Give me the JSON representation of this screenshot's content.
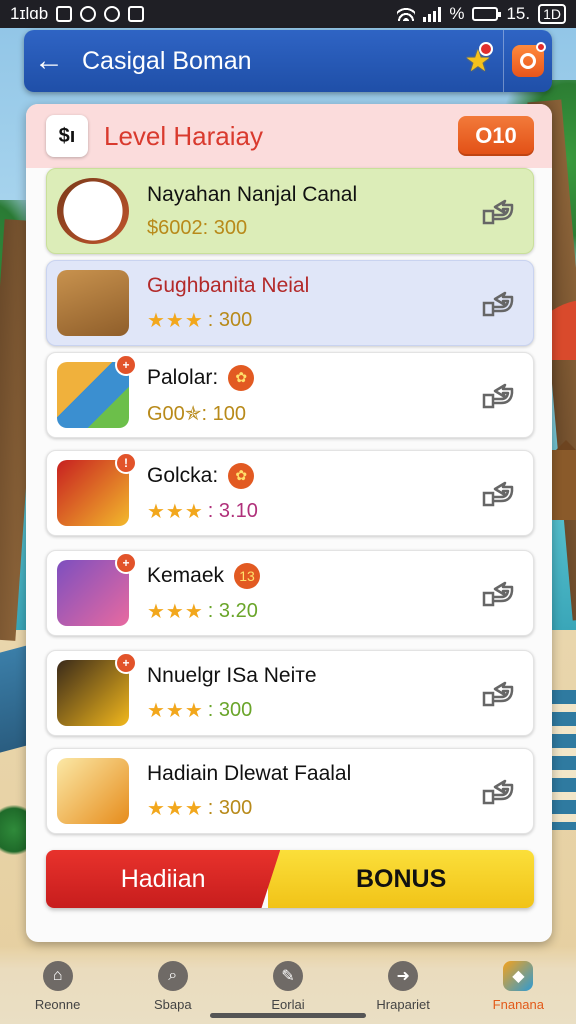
{
  "status_bar": {
    "time_left": "1ɪlɑb",
    "percent": "%",
    "time_right": "15.",
    "right_badge": "1D"
  },
  "header": {
    "title": "Casigal Boman",
    "back_icon": "back-arrow-icon",
    "star_icon": "star-icon",
    "gift_icon": "gift-icon"
  },
  "level": {
    "icon_text": "$ı",
    "title": "Level Haraiay",
    "badge": "O10"
  },
  "items": [
    {
      "title": "Nayahan Nanjal Canal",
      "stars": "",
      "value": "$6002: 300",
      "style": "green",
      "value_color": "#b88a1a",
      "has_title_badge": false,
      "badge": ""
    },
    {
      "title": "Gughbanita Neial",
      "stars": "★★★",
      "value": ": 300",
      "style": "blue",
      "value_color": "#b88a1a",
      "has_title_badge": false,
      "badge": ""
    },
    {
      "title": "Palolar:",
      "stars": "",
      "value": "G00✯: 100",
      "style": "white",
      "value_color": "#b88a1a",
      "has_title_badge": true,
      "title_badge": "✿",
      "badge": "+"
    },
    {
      "title": "Golcka:",
      "stars": "★★★",
      "value": ": 3.10",
      "style": "white",
      "value_color": "#b0307a",
      "has_title_badge": true,
      "title_badge": "✿",
      "badge": "!"
    },
    {
      "title": "Kemaek",
      "stars": "★★★",
      "value": ": 3.20",
      "style": "white",
      "value_color": "#6aa52a",
      "has_title_badge": true,
      "title_badge": "13",
      "badge": "+"
    },
    {
      "title": "Nnuelgr ISa Neiтe",
      "stars": "★★★",
      "value": ": 300",
      "style": "white",
      "value_color": "#6aa52a",
      "has_title_badge": false,
      "badge": "+"
    },
    {
      "title": "Hadiain Dlewat Faalal",
      "stars": "★★★",
      "value": ": 300",
      "style": "white",
      "value_color": "#b88a1a",
      "has_title_badge": false,
      "badge": ""
    }
  ],
  "bonus": {
    "left_label": "Hadiian",
    "right_label": "BONUS"
  },
  "nav": [
    {
      "label": "Reonne",
      "icon": "home-icon",
      "glyph": "⌂",
      "active": false
    },
    {
      "label": "Sbapa",
      "icon": "search-icon",
      "glyph": "⌕",
      "active": false
    },
    {
      "label": "Eorlai",
      "icon": "chat-icon",
      "glyph": "✎",
      "active": false
    },
    {
      "label": "Hrapariet",
      "icon": "forward-icon",
      "glyph": "➜",
      "active": false
    },
    {
      "label": "Fnanana",
      "icon": "promo-icon",
      "glyph": "◆",
      "active": true
    }
  ],
  "colors": {
    "header_blue": "#2f64c4",
    "level_red": "#d93a2e",
    "badge_orange": "#e24f15",
    "bonus_red": "#e8322c",
    "bonus_yellow": "#fbdf3a",
    "star_gold": "#f2a71c"
  }
}
